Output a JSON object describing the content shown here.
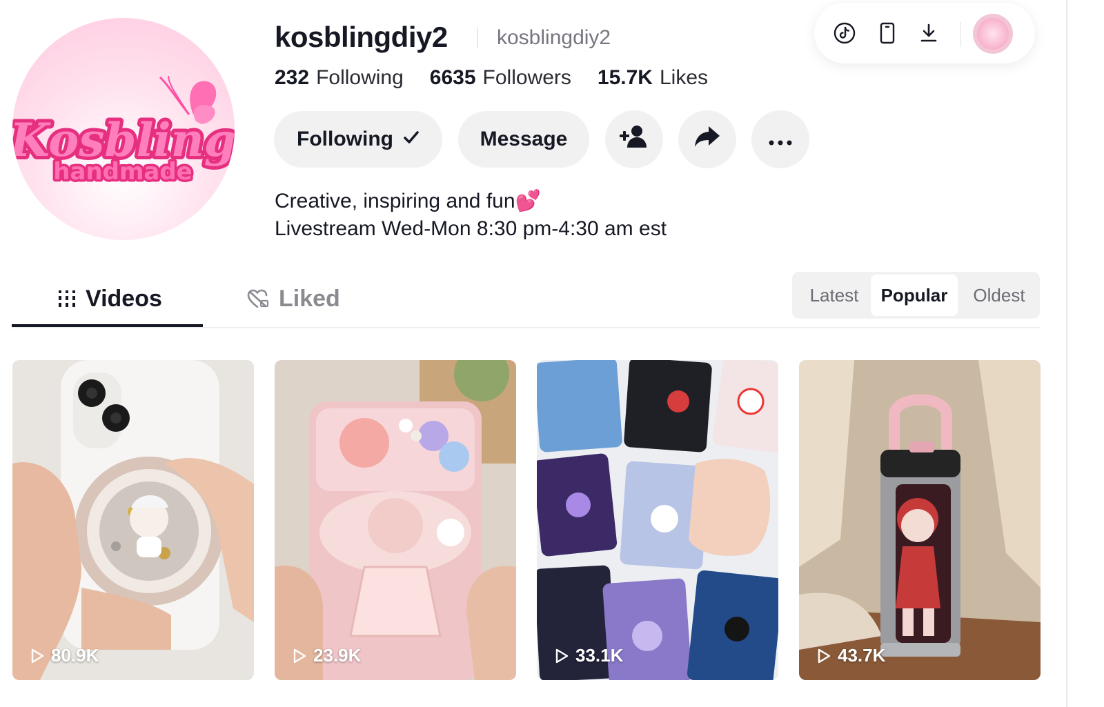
{
  "profile": {
    "username": "kosblingdiy2",
    "nickname": "kosblingdiy2",
    "avatar": {
      "logo_line1": "Kosbling",
      "logo_line2": "handmade"
    },
    "stats": [
      {
        "value": "232",
        "label": "Following"
      },
      {
        "value": "6635",
        "label": "Followers"
      },
      {
        "value": "15.7K",
        "label": "Likes"
      }
    ],
    "bio_line1": "Creative, inspiring and fun💕",
    "bio_line2": "Livestream Wed-Mon 8:30 pm-4:30 am est"
  },
  "actions": {
    "following_label": "Following",
    "following_icon": "checkmark-icon",
    "message_label": "Message",
    "add_friend_icon": "person-add-icon",
    "share_icon": "share-arrow-icon",
    "more_icon": "more-horizontal-icon"
  },
  "toolbar": {
    "icons": [
      "tiktok-logo-icon",
      "phone-icon",
      "download-icon"
    ],
    "avatar": "user-avatar"
  },
  "tabs": [
    {
      "label": "Videos",
      "icon": "grid-icon",
      "active": true
    },
    {
      "label": "Liked",
      "icon": "heart-lock-icon",
      "active": false
    }
  ],
  "sort": {
    "options": [
      "Latest",
      "Popular",
      "Oldest"
    ],
    "selected": "Popular"
  },
  "videos": [
    {
      "views": "80.9K",
      "thumb": "phone-grip-doll"
    },
    {
      "views": "23.9K",
      "thumb": "pink-decoden-phone-case"
    },
    {
      "views": "33.1K",
      "thumb": "decoden-wallet-cases"
    },
    {
      "views": "43.7K",
      "thumb": "decorated-tumbler"
    }
  ],
  "colors": {
    "text_primary": "#161823",
    "text_secondary": "#757580",
    "button_bg": "#f1f1f2",
    "brand_pink": "#f04aa0"
  }
}
